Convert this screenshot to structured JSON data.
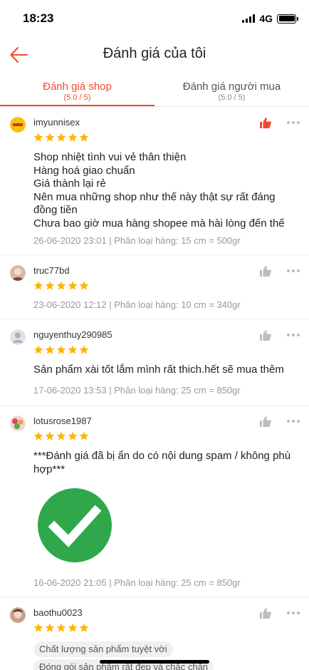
{
  "status_bar": {
    "time": "18:23",
    "network": "4G"
  },
  "header": {
    "title": "Đánh giá của tôi"
  },
  "tabs": [
    {
      "label": "Đánh giá shop",
      "sub": "(5.0 / 5)",
      "active": true
    },
    {
      "label": "Đánh giá người mua",
      "sub": "(5.0 / 5)",
      "active": false
    }
  ],
  "colors": {
    "accent": "#ee4d2d",
    "star": "#ffb600",
    "check_green": "#2ea84a"
  },
  "reviews": [
    {
      "username": "imyunnisex",
      "rating": 5,
      "liked": true,
      "text": "Shop nhiệt tình vui vẻ thân thiện\nHàng hoá giao chuẩn\nGiá thành lại rẻ\nNên mua những shop như thế này thật sự rất đáng đồng tiền\nChưa bao giờ mua hàng shopee mà hài lòng đến thế",
      "meta": "26-06-2020 23:01 | Phân loại hàng: 15 cm = 500gr"
    },
    {
      "username": "truc77bd",
      "rating": 5,
      "liked": false,
      "meta": "23-06-2020 12:12 | Phân loại hàng: 10 cm = 340gr"
    },
    {
      "username": "nguyenthuy290985",
      "rating": 5,
      "liked": false,
      "text": "Sản phẩm xài tốt lắm mình rất thich.hết sẽ mua thêm",
      "meta": "17-06-2020 13:53 | Phân loại hàng: 25 cm = 850gr"
    },
    {
      "username": "lotusrose1987",
      "rating": 5,
      "liked": false,
      "text": "***Đánh giá đã bị ẩn do có nội dung spam / không phù hợp***",
      "meta": "16-06-2020 21:05 | Phân loại hàng: 25 cm = 850gr"
    },
    {
      "username": "baothu0023",
      "rating": 5,
      "liked": false,
      "tags": [
        "Chất lượng sản phẩm tuyệt vời",
        "Đóng gói sản phẩm rất đẹp và chắc chắn"
      ]
    }
  ]
}
